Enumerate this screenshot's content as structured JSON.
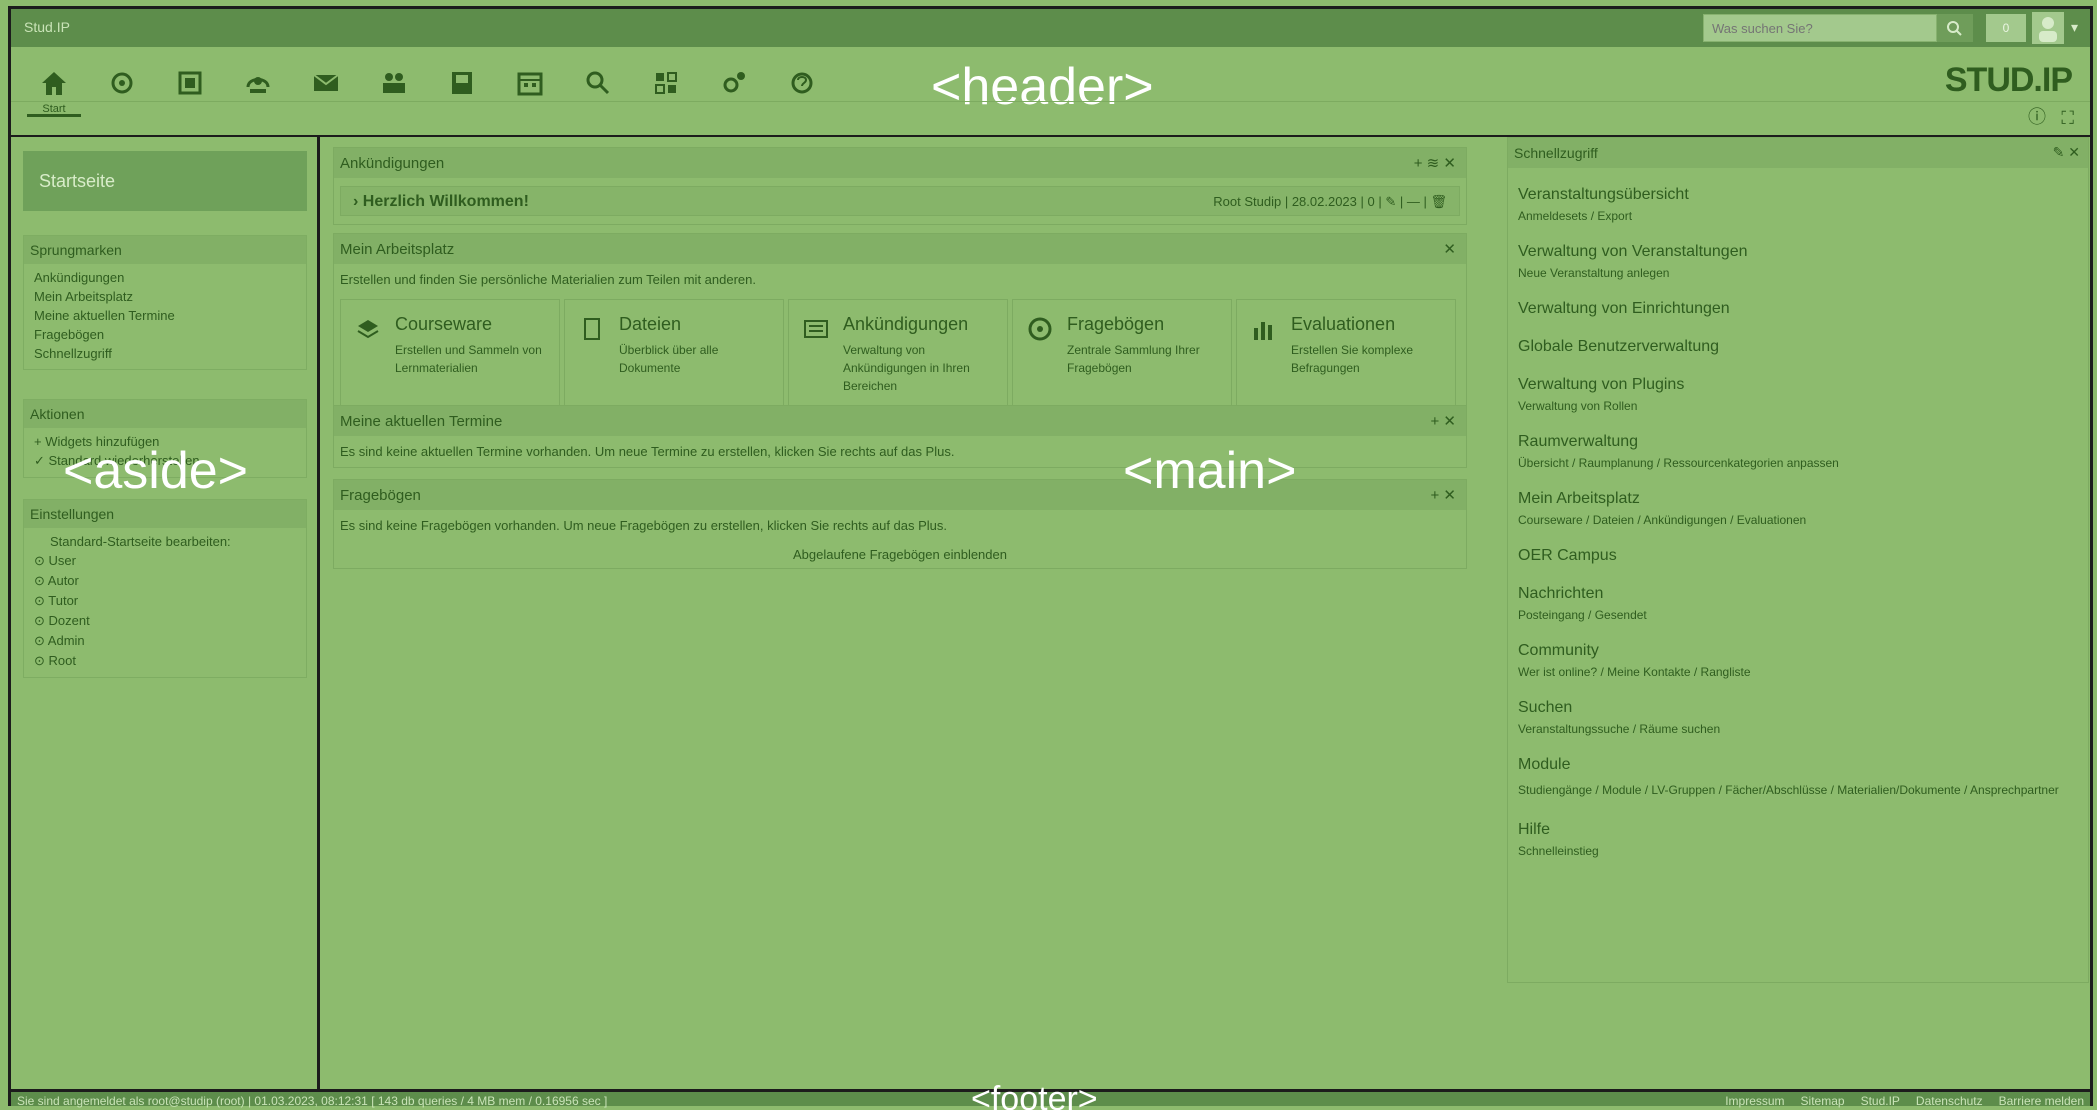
{
  "topbar": {
    "brand": "Stud.IP",
    "search_placeholder": "Was suchen Sie?",
    "notification_count": "0"
  },
  "header": {
    "region_label": "<header>",
    "logo": "STUD.IP",
    "nav": [
      {
        "label": "Start",
        "icon": "home-icon"
      },
      {
        "label": "",
        "icon": "courses-icon"
      },
      {
        "label": "",
        "icon": "calendar-icon"
      },
      {
        "label": "",
        "icon": "community-icon"
      },
      {
        "label": "",
        "icon": "mail-icon"
      },
      {
        "label": "",
        "icon": "people-icon"
      },
      {
        "label": "",
        "icon": "profile-icon"
      },
      {
        "label": "",
        "icon": "schedule-icon"
      },
      {
        "label": "",
        "icon": "search-icon"
      },
      {
        "label": "",
        "icon": "tools-icon"
      },
      {
        "label": "",
        "icon": "admin-icon"
      },
      {
        "label": "",
        "icon": "help-plugin-icon"
      }
    ]
  },
  "aside": {
    "region_label": "<aside>",
    "startseite": "Startseite",
    "sprungmarken": {
      "title": "Sprungmarken",
      "items": [
        "Ankündigungen",
        "Mein Arbeitsplatz",
        "Meine aktuellen Termine",
        "Fragebögen",
        "Schnellzugriff"
      ]
    },
    "aktionen": {
      "title": "Aktionen",
      "items": [
        "Widgets hinzufügen",
        "Standard wiederherstellen"
      ]
    },
    "einstellungen": {
      "title": "Einstellungen",
      "subtitle": "Standard-Startseite bearbeiten:",
      "items": [
        "User",
        "Autor",
        "Tutor",
        "Dozent",
        "Admin",
        "Root"
      ]
    }
  },
  "main": {
    "region_label": "<main>",
    "ankuendigungen": {
      "title": "Ankündigungen",
      "announcement_title": "Herzlich Willkommen!",
      "author": "Root Studip",
      "date": "28.02.2023",
      "count": "0"
    },
    "arbeitsplatz": {
      "title": "Mein Arbeitsplatz",
      "intro": "Erstellen und finden Sie persönliche Materialien zum Teilen mit anderen.",
      "tiles": [
        {
          "title": "Courseware",
          "desc": "Erstellen und Sammeln von Lernmaterialien"
        },
        {
          "title": "Dateien",
          "desc": "Überblick über alle Dokumente"
        },
        {
          "title": "Ankündigungen",
          "desc": "Verwaltung von Ankündigungen in Ihren Bereichen"
        },
        {
          "title": "Fragebögen",
          "desc": "Zentrale Sammlung Ihrer Fragebögen"
        },
        {
          "title": "Evaluationen",
          "desc": "Erstellen Sie komplexe Befragungen"
        }
      ]
    },
    "termine": {
      "title": "Meine aktuellen Termine",
      "text": "Es sind keine aktuellen Termine vorhanden. Um neue Termine zu erstellen, klicken Sie rechts auf das Plus."
    },
    "frageboegen": {
      "title": "Fragebögen",
      "text": "Es sind keine Fragebögen vorhanden. Um neue Fragebögen zu erstellen, klicken Sie rechts auf das Plus.",
      "link": "Abgelaufene Fragebögen einblenden"
    }
  },
  "schnellzugriff": {
    "title": "Schnellzugriff",
    "entries": [
      {
        "title": "Veranstaltungsübersicht",
        "sub": "Anmeldesets / Export"
      },
      {
        "title": "Verwaltung von Veranstaltungen",
        "sub": "Neue Veranstaltung anlegen"
      },
      {
        "title": "Verwaltung von Einrichtungen",
        "sub": ""
      },
      {
        "title": "Globale Benutzerverwaltung",
        "sub": ""
      },
      {
        "title": "Verwaltung von Plugins",
        "sub": "Verwaltung von Rollen"
      },
      {
        "title": "Raumverwaltung",
        "sub": "Übersicht / Raumplanung / Ressourcenkategorien anpassen"
      },
      {
        "title": "Mein Arbeitsplatz",
        "sub": "Courseware / Dateien / Ankündigungen / Evaluationen"
      },
      {
        "title": "OER Campus",
        "sub": ""
      },
      {
        "title": "Nachrichten",
        "sub": "Posteingang / Gesendet"
      },
      {
        "title": "Community",
        "sub": "Wer ist online? / Meine Kontakte / Rangliste"
      },
      {
        "title": "Suchen",
        "sub": "Veranstaltungssuche / Räume suchen"
      },
      {
        "title": "Module",
        "sub": "Studiengänge / Module / LV-Gruppen / Fächer/Abschlüsse / Materialien/Dokumente / Ansprechpartner"
      },
      {
        "title": "Hilfe",
        "sub": "Schnelleinstieg"
      }
    ]
  },
  "footer": {
    "region_label": "<footer>",
    "status": "Sie sind angemeldet als root@studip (root) | 01.03.2023, 08:12:31 [ 143 db queries / 4 MB mem / 0.16956 sec ]",
    "links": [
      "Impressum",
      "Sitemap",
      "Stud.IP",
      "Datenschutz",
      "Barriere melden"
    ]
  }
}
